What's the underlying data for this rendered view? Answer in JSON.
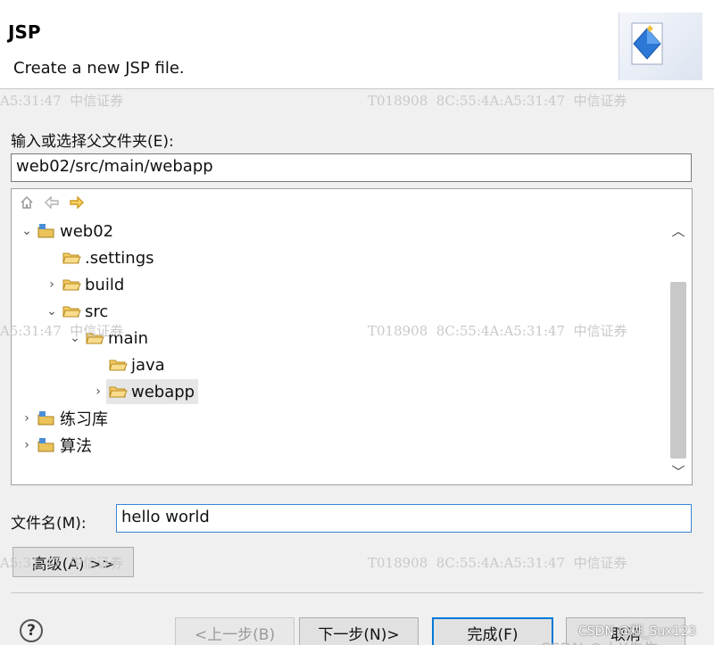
{
  "header": {
    "title": "JSP",
    "description": "Create a new JSP file."
  },
  "watermarks": {
    "row1_left": "A5:31:47  中信证券",
    "row1_right": "T018908  8C:55:4A:A5:31:47  中信证券",
    "row2_left": "A5:31:47  中信证券",
    "row2_right": "T018908  8C:55:4A:A5:31:47  中信证券",
    "row3_left": "A5:31:47  中信证券",
    "row3_right": "T018908  8C:55:4A:A5:31:47  中信证券"
  },
  "parent_folder": {
    "label": "输入或选择父文件夹(E):",
    "value": "web02/src/main/webapp"
  },
  "tree": {
    "toolbar": [
      "home-icon",
      "back-arrow-icon",
      "forward-arrow-icon"
    ],
    "nodes": [
      {
        "label": "web02",
        "twisty": "expanded",
        "icon": "project-icon"
      },
      {
        "label": ".settings",
        "twisty": "none",
        "icon": "folder-icon"
      },
      {
        "label": "build",
        "twisty": "collapsed",
        "icon": "folder-icon"
      },
      {
        "label": "src",
        "twisty": "expanded",
        "icon": "folder-icon"
      },
      {
        "label": "main",
        "twisty": "expanded",
        "icon": "folder-icon"
      },
      {
        "label": "java",
        "twisty": "none",
        "icon": "folder-icon"
      },
      {
        "label": "webapp",
        "twisty": "collapsed",
        "icon": "folder-icon",
        "selected": true
      },
      {
        "label": "练习库",
        "twisty": "collapsed",
        "icon": "project-icon"
      },
      {
        "label": "算法",
        "twisty": "collapsed",
        "icon": "project-icon"
      }
    ]
  },
  "file_name": {
    "label": "文件名(M):",
    "value": "hello world"
  },
  "advanced_button": "高级(A) >>",
  "buttons": {
    "back": "<上一步(B)",
    "next": "下一步(N)>",
    "finish": "完成(F)",
    "cancel": "取消"
  },
  "footer_watermark": "CSDN @糊_Sux123",
  "footer_watermark2": "CSDN @小K先生",
  "colors": {
    "accent": "#0078d7",
    "folder": "#e8b84a",
    "selection": "#e6e6e6"
  }
}
